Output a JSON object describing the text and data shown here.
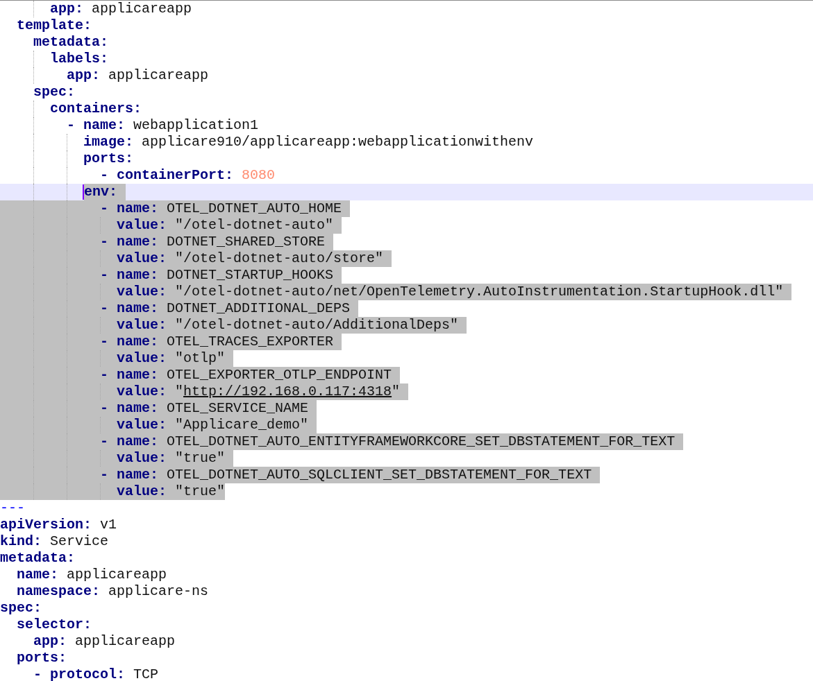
{
  "editor": {
    "documents": [
      {
        "lines": [
          {
            "children": [
              {
                "children": [
                  {
                    "children": [
                      {
                        "key": "app:",
                        "value": "applicareapp",
                        "selected": false,
                        "current": false
                      }
                    ]
                  }
                ]
              },
              {
                "key": "template:",
                "selected": false,
                "current": false,
                "children": [
                  {
                    "key": "metadata:",
                    "selected": false,
                    "current": false,
                    "children": [
                      {
                        "key": "labels:",
                        "selected": false,
                        "current": false,
                        "children": [
                          {
                            "key": "app:",
                            "value": "applicareapp",
                            "selected": false,
                            "current": false
                          }
                        ]
                      }
                    ]
                  },
                  {
                    "key": "spec:",
                    "selected": false,
                    "current": false,
                    "children": [
                      {
                        "key": "containers:",
                        "selected": false,
                        "current": false,
                        "children": [
                          {
                            "dash": "-",
                            "key": "name:",
                            "value": "webapplication1",
                            "selected": false,
                            "current": false,
                            "children": [
                              {
                                "key": "image:",
                                "value": "applicare910/applicareapp:webapplicationwithenv",
                                "selected": false,
                                "current": false
                              },
                              {
                                "key": "ports:",
                                "selected": false,
                                "current": false,
                                "children": [
                                  {
                                    "dash": "-",
                                    "key": "containerPort:",
                                    "value": "8080",
                                    "kind": "number",
                                    "selected": false,
                                    "current": false
                                  }
                                ]
                              },
                              {
                                "key": "env:",
                                "selected": true,
                                "current": true,
                                "children": [
                                  {
                                    "dash": "-",
                                    "key": "name:",
                                    "value": "OTEL_DOTNET_AUTO_HOME",
                                    "selected": true,
                                    "current": false,
                                    "children": [
                                      {
                                        "key": "value:",
                                        "value": "\"/otel-dotnet-auto\"",
                                        "selected": true,
                                        "current": false
                                      }
                                    ]
                                  },
                                  {
                                    "dash": "-",
                                    "key": "name:",
                                    "value": "DOTNET_SHARED_STORE",
                                    "selected": true,
                                    "current": false,
                                    "children": [
                                      {
                                        "key": "value:",
                                        "value": "\"/otel-dotnet-auto/store\"",
                                        "selected": true,
                                        "current": false
                                      }
                                    ]
                                  },
                                  {
                                    "dash": "-",
                                    "key": "name:",
                                    "value": "DOTNET_STARTUP_HOOKS",
                                    "selected": true,
                                    "current": false,
                                    "children": [
                                      {
                                        "key": "value:",
                                        "value": "\"/otel-dotnet-auto/net/OpenTelemetry.AutoInstrumentation.StartupHook.dll\"",
                                        "selected": true,
                                        "current": false
                                      }
                                    ]
                                  },
                                  {
                                    "dash": "-",
                                    "key": "name:",
                                    "value": "DOTNET_ADDITIONAL_DEPS",
                                    "selected": true,
                                    "current": false,
                                    "children": [
                                      {
                                        "key": "value:",
                                        "value": "\"/otel-dotnet-auto/AdditionalDeps\"",
                                        "selected": true,
                                        "current": false
                                      }
                                    ]
                                  },
                                  {
                                    "dash": "-",
                                    "key": "name:",
                                    "value": "OTEL_TRACES_EXPORTER",
                                    "selected": true,
                                    "current": false,
                                    "children": [
                                      {
                                        "key": "value:",
                                        "value": "\"otlp\"",
                                        "selected": true,
                                        "current": false
                                      }
                                    ]
                                  },
                                  {
                                    "dash": "-",
                                    "key": "name:",
                                    "value": "OTEL_EXPORTER_OTLP_ENDPOINT",
                                    "selected": true,
                                    "current": false,
                                    "children": [
                                      {
                                        "key": "value:",
                                        "value": "\"http://192.168.0.117:4318\"",
                                        "kind": "url",
                                        "selected": true,
                                        "current": false
                                      }
                                    ]
                                  },
                                  {
                                    "dash": "-",
                                    "key": "name:",
                                    "value": "OTEL_SERVICE_NAME",
                                    "selected": true,
                                    "current": false,
                                    "children": [
                                      {
                                        "key": "value:",
                                        "value": "\"Applicare_demo\"",
                                        "selected": true,
                                        "current": false
                                      }
                                    ]
                                  },
                                  {
                                    "dash": "-",
                                    "key": "name:",
                                    "value": "OTEL_DOTNET_AUTO_ENTITYFRAMEWORKCORE_SET_DBSTATEMENT_FOR_TEXT",
                                    "selected": true,
                                    "current": false,
                                    "children": [
                                      {
                                        "key": "value:",
                                        "value": "\"true\"",
                                        "selected": true,
                                        "current": false
                                      }
                                    ]
                                  },
                                  {
                                    "dash": "-",
                                    "key": "name:",
                                    "value": "OTEL_DOTNET_AUTO_SQLCLIENT_SET_DBSTATEMENT_FOR_TEXT",
                                    "selected": true,
                                    "current": false,
                                    "children": [
                                      {
                                        "key": "value:",
                                        "value": "\"true\"",
                                        "selected": true,
                                        "current": false
                                      }
                                    ]
                                  }
                                ]
                              }
                            ]
                          }
                        ]
                      }
                    ]
                  }
                ]
              }
            ]
          }
        ]
      },
      {
        "separator": "---",
        "lines": [
          {
            "key": "apiVersion:",
            "value": "v1",
            "selected": false,
            "current": false
          },
          {
            "key": "kind:",
            "value": "Service",
            "selected": false,
            "current": false
          },
          {
            "key": "metadata:",
            "selected": false,
            "current": false,
            "children": [
              {
                "key": "name:",
                "value": "applicareapp",
                "selected": false,
                "current": false
              },
              {
                "key": "namespace:",
                "value": "applicare-ns",
                "selected": false,
                "current": false
              }
            ]
          },
          {
            "key": "spec:",
            "selected": false,
            "current": false,
            "children": [
              {
                "key": "selector:",
                "selected": false,
                "current": false,
                "children": [
                  {
                    "key": "app:",
                    "value": "applicareapp",
                    "selected": false,
                    "current": false
                  }
                ]
              },
              {
                "key": "ports:",
                "selected": false,
                "current": false,
                "children": [
                  {
                    "dash": "-",
                    "key": "protocol:",
                    "value": "TCP",
                    "selected": false,
                    "current": false
                  }
                ]
              }
            ]
          }
        ]
      }
    ]
  }
}
